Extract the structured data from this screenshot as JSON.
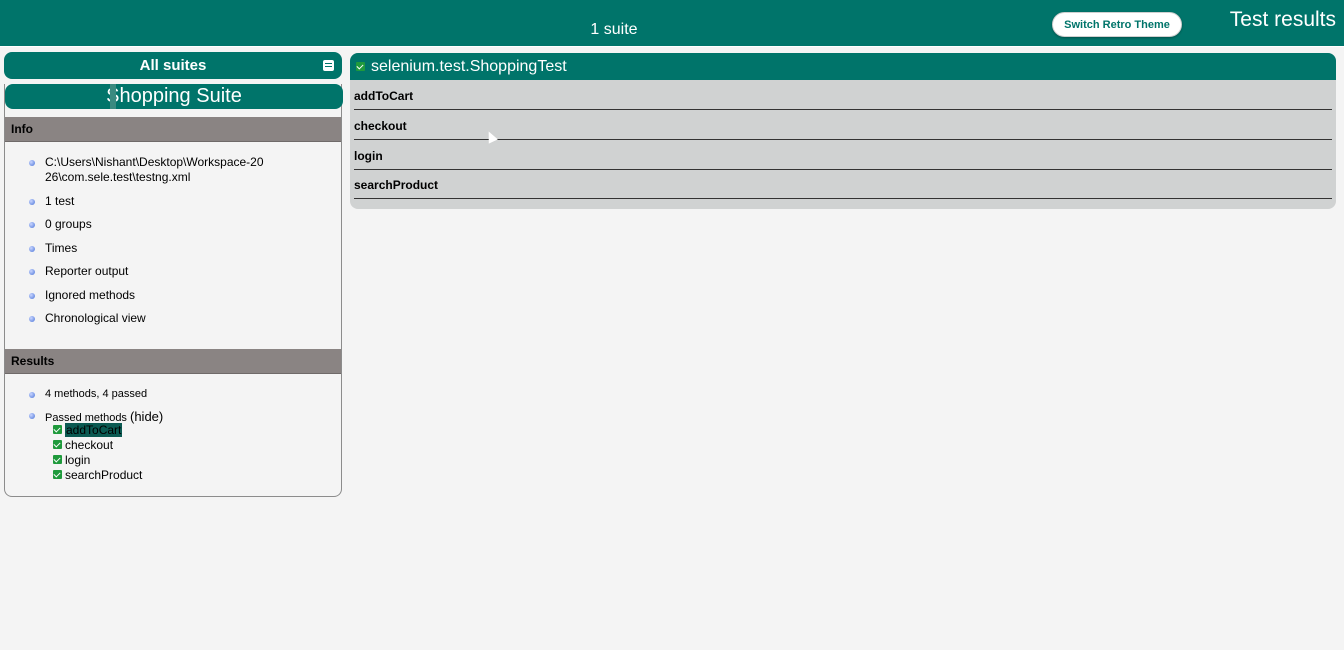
{
  "header": {
    "suite_count": "1 suite",
    "retro_button": "Switch Retro Theme",
    "title": "Test results"
  },
  "nav": {
    "all_suites": "All suites",
    "suite_name": "Shopping Suite",
    "info_heading": "Info",
    "info_items": [
      "C:\\Users\\Nishant\\Desktop\\Workspace-2026\\com.sele.test\\testng.xml",
      "1 test",
      "0 groups",
      "Times",
      "Reporter output",
      "Ignored methods",
      "Chronological view"
    ],
    "results_heading": "Results",
    "summary": "4 methods, 4 passed",
    "passed_label": "Passed methods",
    "hide_link": "(hide)",
    "passed_methods": [
      "addToCart",
      "checkout",
      "login",
      "searchProduct"
    ]
  },
  "main": {
    "class_name": "selenium.test.ShoppingTest",
    "methods": [
      "addToCart",
      "checkout",
      "login",
      "searchProduct"
    ]
  },
  "colors": {
    "primary": "#00746a",
    "section_header": "#8a8483",
    "panel_bg": "#d0d2d2",
    "pass": "#1f9a3c"
  }
}
